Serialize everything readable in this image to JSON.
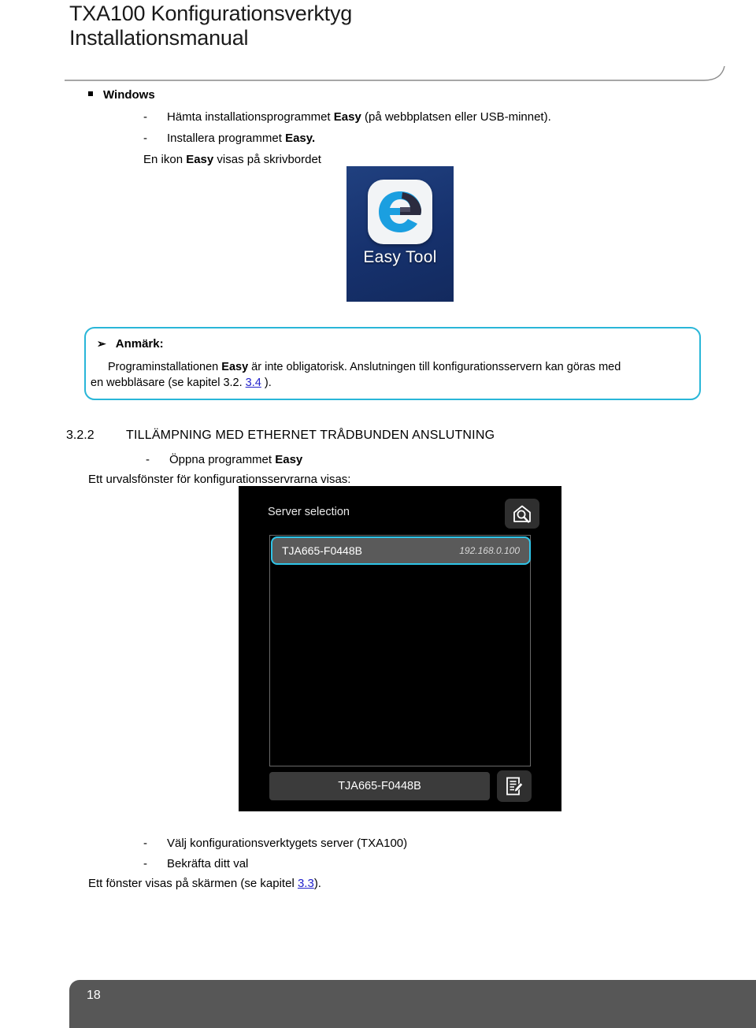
{
  "header": {
    "title": "TXA100 Konfigurationsverktyg",
    "subtitle": "Installationsmanual"
  },
  "windows_section": {
    "heading": "Windows",
    "steps": [
      {
        "dash": "-",
        "text_before": "Hämta installationsprogrammet ",
        "bold": "Easy",
        "text_after": " (på webbplatsen eller USB-minnet)."
      },
      {
        "dash": "-",
        "text_before": "Installera programmet ",
        "bold": "Easy.",
        "text_after": ""
      }
    ],
    "desktop_note_before": "En ikon ",
    "desktop_note_bold": "Easy",
    "desktop_note_after": " visas på skrivbordet"
  },
  "easy_icon": {
    "label": "Easy Tool",
    "bg_color": "#1b3a7a",
    "tile_color": "#f2f4f6",
    "e_blue": "#1b9fe0",
    "e_dark": "#2b2b3f"
  },
  "note": {
    "arrow_glyph": "➢",
    "title": "Anmärk:",
    "line1_a": "Programinstallationen ",
    "line1_bold": "Easy",
    "line1_b": " är inte obligatorisk. Anslutningen till konfigurationsservern kan göras med",
    "line2_a": "en webbläsare (se kapitel 3.2. ",
    "line2_link": "3.4",
    "line2_b": " ).",
    "border_color": "#29b6d8",
    "link_color": "#2222cc"
  },
  "section": {
    "number": "3.2.2",
    "title": "TILLÄMPNING MED ETHERNET TRÅDBUNDEN ANSLUTNING",
    "step_dash": "-",
    "step_text_before": "Öppna programmet ",
    "step_text_bold": "Easy",
    "intro": "Ett urvalsfönster för konfigurationsservrarna visas:"
  },
  "app_screenshot": {
    "window_title": "Server selection",
    "search_icon": "house-search-icon",
    "edit_icon": "document-edit-icon",
    "selected_row": {
      "name": "TJA665-F0448B",
      "ip": "192.168.0.100",
      "highlight_color": "#2fc4e8"
    },
    "confirm_button_label": "TJA665-F0448B"
  },
  "bottom_steps": {
    "steps": [
      {
        "dash": "-",
        "text": "Välj konfigurationsverktygets server (TXA100)"
      },
      {
        "dash": "-",
        "text": "Bekräfta ditt val"
      }
    ],
    "closing_a": "Ett fönster visas på skärmen (se kapitel ",
    "closing_link": "3.3",
    "closing_b": ")."
  },
  "footer": {
    "page_number": "18",
    "bar_color": "#575757"
  }
}
